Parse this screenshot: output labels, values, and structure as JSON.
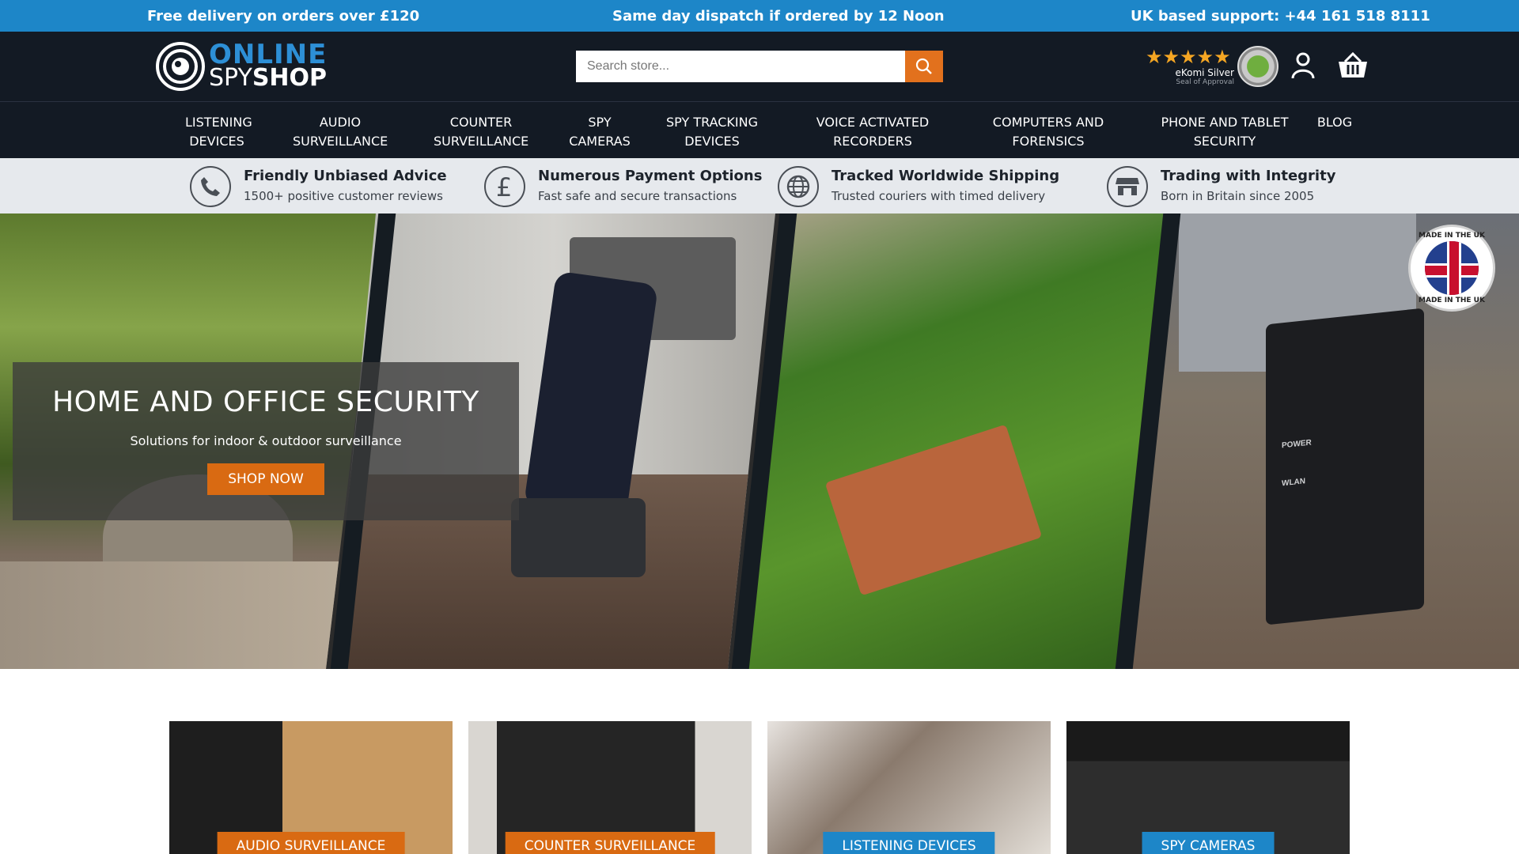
{
  "topbar": {
    "delivery": "Free delivery on orders over £120",
    "dispatch": "Same day dispatch if ordered by 12 Noon",
    "support": "UK based support: +44 161 518 8111"
  },
  "header": {
    "logo_line1": "ONLINE",
    "logo_spy": "SPY",
    "logo_shop": "SHOP",
    "search_placeholder": "Search store...",
    "ekomi": {
      "stars": "★★★★★",
      "name": "eKomi Silver",
      "sub": "Seal of Approval"
    }
  },
  "nav": {
    "items": [
      {
        "label": "LISTENING\nDEVICES"
      },
      {
        "label": "AUDIO\nSURVEILLANCE"
      },
      {
        "label": "COUNTER\nSURVEILLANCE"
      },
      {
        "label": "SPY\nCAMERAS"
      },
      {
        "label": "SPY TRACKING\nDEVICES"
      },
      {
        "label": "VOICE ACTIVATED\nRECORDERS"
      },
      {
        "label": "COMPUTERS AND\nFORENSICS"
      },
      {
        "label": "PHONE AND TABLET\nSECURITY"
      },
      {
        "label": "BLOG"
      }
    ]
  },
  "usp": [
    {
      "title": "Friendly Unbiased Advice",
      "sub": "1500+ positive customer reviews",
      "icon": "phone-icon"
    },
    {
      "title": "Numerous Payment Options",
      "sub": "Fast safe and secure transactions",
      "icon": "pound-icon"
    },
    {
      "title": "Tracked Worldwide Shipping",
      "sub": "Trusted couriers with timed delivery",
      "icon": "globe-icon"
    },
    {
      "title": "Trading with Integrity",
      "sub": "Born in Britain since 2005",
      "icon": "shop-icon"
    }
  ],
  "hero": {
    "title": "HOME AND OFFICE SECURITY",
    "subtitle": "Solutions for indoor & outdoor surveillance",
    "button": "SHOP NOW",
    "badge_top": "MADE IN THE UK",
    "badge_bottom": "MADE IN THE UK",
    "router_power": "POWER",
    "router_wlan": "WLAN"
  },
  "cards": [
    {
      "label": "AUDIO SURVEILLANCE",
      "color": "#d96a12"
    },
    {
      "label": "COUNTER SURVEILLANCE",
      "color": "#d96a12"
    },
    {
      "label": "LISTENING DEVICES",
      "color": "#1d86c8"
    },
    {
      "label": "SPY CAMERAS",
      "color": "#1d86c8"
    }
  ],
  "colors": {
    "topbar": "#1d86c8",
    "header": "#131a24",
    "accent": "#e2711d",
    "usp_bg": "#e6e9ed"
  }
}
